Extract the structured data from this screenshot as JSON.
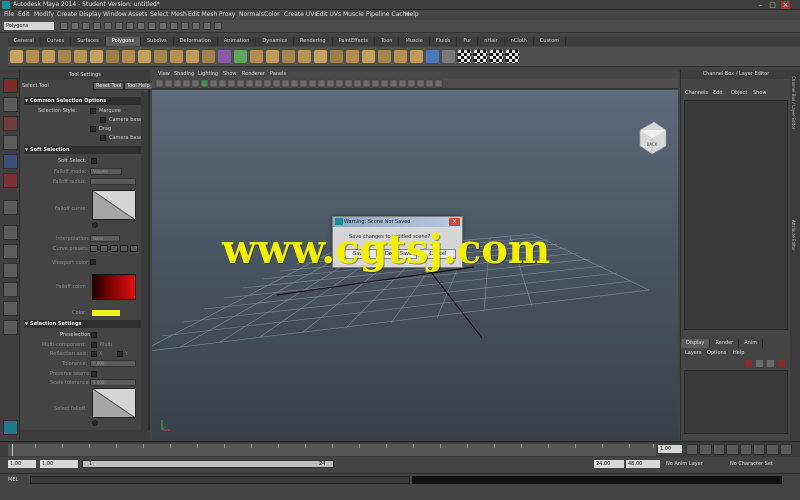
{
  "window": {
    "title": "Autodesk Maya 2014 - Student Version: untitled*"
  },
  "menubar": [
    "File",
    "Edit",
    "Modify",
    "Create",
    "Display",
    "Window",
    "Assets",
    "Select",
    "Mesh",
    "Edit Mesh",
    "Proxy",
    "Normals",
    "Color",
    "Create UVs",
    "Edit UVs",
    "Muscle",
    "Pipeline Cache",
    "Help"
  ],
  "status_line": {
    "mode": "Polygons"
  },
  "shelf_tabs": [
    "General",
    "Curves",
    "Surfaces",
    "Polygons",
    "Subdivs",
    "Deformation",
    "Animation",
    "Dynamics",
    "Rendering",
    "PaintEffects",
    "Toon",
    "Muscle",
    "Fluids",
    "Fur",
    "nHair",
    "nCloth",
    "Custom"
  ],
  "shelf_active_tab": "Polygons",
  "tool_settings": {
    "panel_title": "Tool Settings",
    "tool_name": "Select Tool",
    "reset_label": "Reset Tool",
    "help_label": "Tool Help",
    "sections": {
      "common": "Common Selection Options",
      "soft": "Soft Selection",
      "selection": "Selection Settings"
    },
    "common": {
      "selection_style": "Selection Style:",
      "opt1": "Marquee",
      "opt2": "Camera based",
      "opt3": "Drag",
      "opt4": "Camera based"
    },
    "soft": {
      "soft_select": "Soft Select:",
      "falloff_mode": "Falloff mode:",
      "falloff_mode_value": "Volume",
      "falloff_radius": "Falloff radius:",
      "falloff_curve": "Falloff curve:",
      "interpolation": "Interpolation:",
      "interpolation_value": "None",
      "curve_presets": "Curve presets:",
      "viewport_color": "Viewport color:",
      "falloff_color": "Falloff color:",
      "color": "Color:"
    },
    "selection": {
      "preselection": "Preselection:",
      "mode": "Multi-component:",
      "mode_value": "Multi",
      "reflection": "Reflection axis:",
      "axis_x": "X",
      "axis_y": "Y",
      "tolerance": "Tolerance:",
      "tolerance_value": "0.000",
      "preserve": "Preserve seams:",
      "scale": "Scale tolerance:",
      "scale_value": "1.000",
      "soft_falloff": "Select falloff:"
    }
  },
  "viewport": {
    "menu": [
      "View",
      "Shading",
      "Lighting",
      "Show",
      "Renderer",
      "Panels"
    ],
    "viewcube_label": "BACK"
  },
  "dialog": {
    "title": "Warning: Scene Not Saved",
    "message": "Save changes to untitled scene?",
    "buttons": [
      "Save",
      "Don't Save",
      "Cancel"
    ]
  },
  "watermark": "www.cgtsj.com",
  "channel_box": {
    "title": "Channel Box / Layer Editor",
    "menu": [
      "Channels",
      "Edit",
      "Object",
      "Show"
    ],
    "layer_tabs": [
      "Display",
      "Render",
      "Anim"
    ],
    "layer_menu": [
      "Layers",
      "Options",
      "Help"
    ],
    "side_labels": [
      "Channel Box / Layer Editor",
      "Attribute Editor"
    ]
  },
  "time_slider": {
    "ticks": [
      "1",
      "2",
      "4",
      "6",
      "8",
      "10",
      "12",
      "14",
      "16",
      "18",
      "20",
      "22",
      "24"
    ],
    "current_frame": "1.00"
  },
  "range_slider": {
    "start": "1.00",
    "playback_start": "1.00",
    "bar_start": "1",
    "bar_end": "24",
    "playback_end": "24.00",
    "end": "48.00",
    "anim_layer": "No Anim Layer",
    "character_set": "No Character Set"
  },
  "command_line": {
    "label": "MEL"
  },
  "colors": {
    "falloff_color": "#f2ef22",
    "watermark": "#f4f000",
    "viewport_top": "#5b6a7c",
    "viewport_bottom": "#394049"
  }
}
